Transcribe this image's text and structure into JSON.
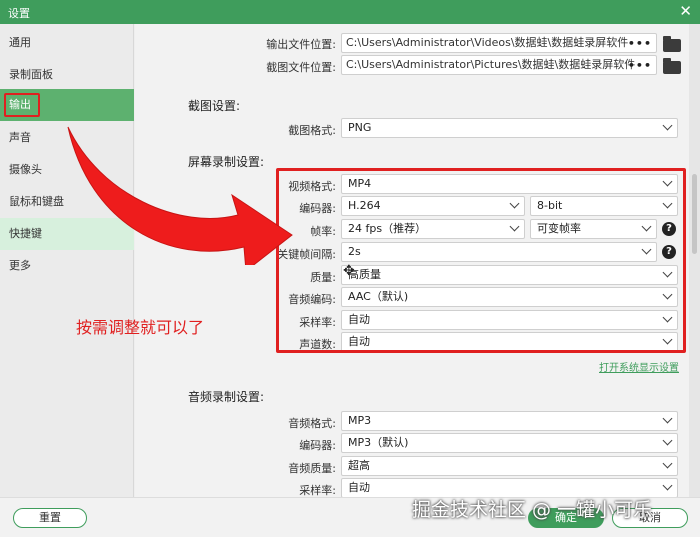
{
  "window": {
    "title": "设置",
    "close": "✕"
  },
  "sidebar": {
    "items": [
      {
        "label": "通用"
      },
      {
        "label": "录制面板"
      },
      {
        "label": "输出"
      },
      {
        "label": "声音"
      },
      {
        "label": "摄像头"
      },
      {
        "label": "鼠标和键盘"
      },
      {
        "label": "快捷键"
      },
      {
        "label": "更多"
      }
    ]
  },
  "output": {
    "file_location_label": "输出文件位置:",
    "file_location_value": "C:\\Users\\Administrator\\Videos\\数据蛙\\数据蛙录屏软件",
    "screenshot_location_label": "截图文件位置:",
    "screenshot_location_value": "C:\\Users\\Administrator\\Pictures\\数据蛙\\数据蛙录屏软件",
    "browse_dots": "•••"
  },
  "screenshot_settings": {
    "heading": "截图设置:",
    "format_label": "截图格式:",
    "format_value": "PNG"
  },
  "screen_recording": {
    "heading": "屏幕录制设置:",
    "video_format_label": "视频格式:",
    "video_format_value": "MP4",
    "encoder_label": "编码器:",
    "encoder_value": "H.264",
    "bit_depth_value": "8-bit",
    "framerate_label": "帧率:",
    "framerate_value": "24 fps（推荐）",
    "framerate_mode_value": "可变帧率",
    "keyframe_label": "关键帧间隔:",
    "keyframe_value": "2s",
    "quality_label": "质量:",
    "quality_value": "高质量",
    "audio_codec_label": "音频编码:",
    "audio_codec_value": "AAC（默认)",
    "sample_rate_label": "采样率:",
    "sample_rate_value": "自动",
    "channels_label": "声道数:",
    "channels_value": "自动",
    "help_glyph": "?",
    "open_display_settings": "打开系统显示设置"
  },
  "audio_recording": {
    "heading": "音频录制设置:",
    "format_label": "音频格式:",
    "format_value": "MP3",
    "encoder_label": "编码器:",
    "encoder_value": "MP3（默认)",
    "quality_label": "音频质量:",
    "quality_value": "超高",
    "sample_rate_label": "采样率:",
    "sample_rate_value": "自动"
  },
  "annotation": "按需调整就可以了",
  "footer": {
    "reset": "重置",
    "ok": "确定",
    "cancel": "取消"
  },
  "watermark": "掘金技术社区 @ 一罐小可乐",
  "colors": {
    "accent": "#3f9d5c",
    "annotation": "#e02020"
  }
}
